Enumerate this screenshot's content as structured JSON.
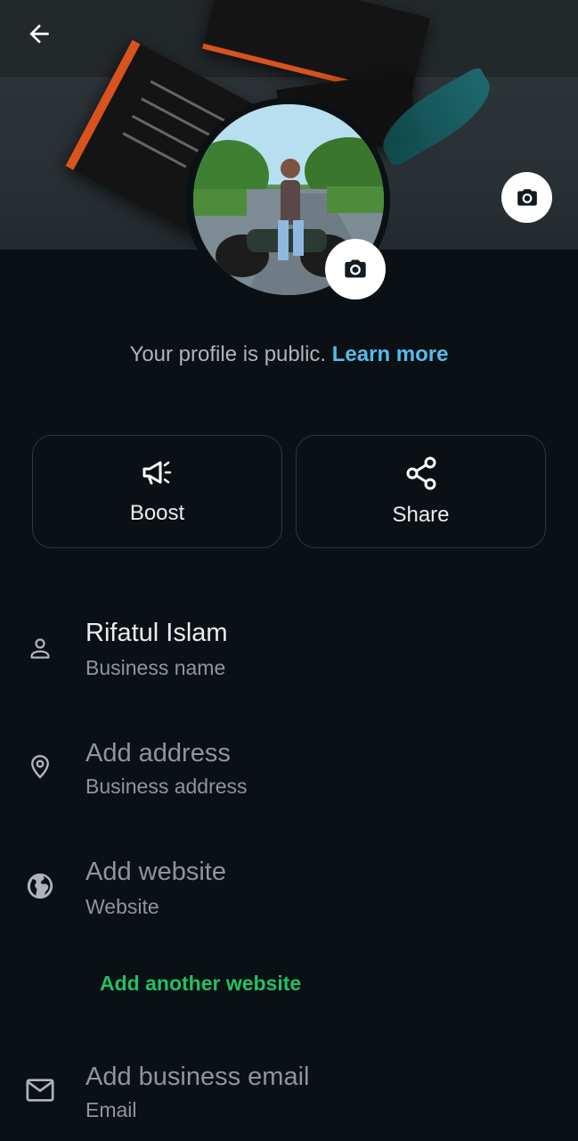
{
  "header": {
    "back_icon": "arrow-left-icon"
  },
  "profile": {
    "cover_camera_icon": "camera-icon",
    "avatar_camera_icon": "camera-icon",
    "public_text": "Your profile is public.",
    "learn_more": "Learn more"
  },
  "actions": [
    {
      "label": "Boost",
      "icon": "megaphone-icon"
    },
    {
      "label": "Share",
      "icon": "share-icon"
    }
  ],
  "fields": {
    "name": {
      "value": "Rifatul Islam",
      "label": "Business name",
      "icon": "person-icon"
    },
    "address": {
      "value": "Add address",
      "label": "Business address",
      "icon": "location-pin-icon"
    },
    "website": {
      "value": "Add website",
      "label": "Website",
      "icon": "globe-icon"
    },
    "add_website": "Add another website",
    "email": {
      "value": "Add business email",
      "label": "Email",
      "icon": "mail-icon"
    }
  },
  "colors": {
    "accent_link": "#53bdeb",
    "accent_green": "#21c063",
    "background": "#0b1014"
  }
}
